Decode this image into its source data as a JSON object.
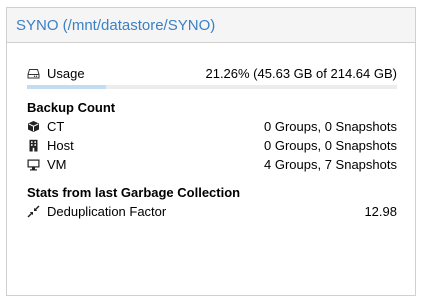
{
  "panel": {
    "title": "SYNO (/mnt/datastore/SYNO)"
  },
  "usage": {
    "icon": "hdd-icon",
    "label": "Usage",
    "value": "21.26% (45.63 GB of 214.64 GB)",
    "fraction": 0.2126,
    "bar_color": "#c4dcf0"
  },
  "backup_count": {
    "heading": "Backup Count",
    "items": [
      {
        "icon": "cube-icon",
        "label": "CT",
        "value": "0 Groups, 0 Snapshots"
      },
      {
        "icon": "building-icon",
        "label": "Host",
        "value": "0 Groups, 0 Snapshots"
      },
      {
        "icon": "desktop-icon",
        "label": "VM",
        "value": "4 Groups, 7 Snapshots"
      }
    ]
  },
  "gc": {
    "heading": "Stats from last Garbage Collection",
    "items": [
      {
        "icon": "compress-icon",
        "label": "Deduplication Factor",
        "value": "12.98"
      }
    ]
  },
  "colors": {
    "title": "#3b80c5",
    "header_bg": "#f5f5f5",
    "border": "#d0d0d0"
  }
}
